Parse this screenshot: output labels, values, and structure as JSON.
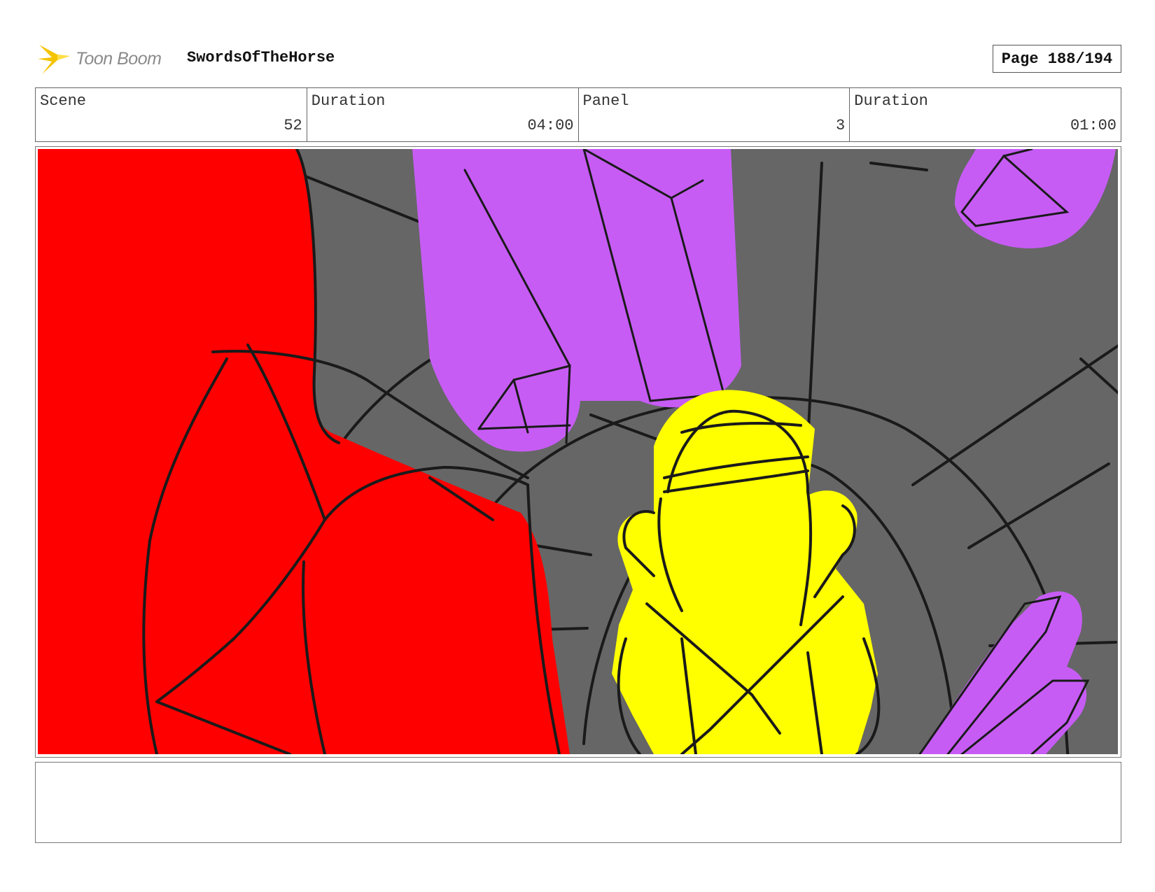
{
  "header": {
    "logo_text": "Toon Boom",
    "project_title": "SwordsOfTheHorse",
    "page_label": "Page 188/194"
  },
  "info": {
    "scene_label": "Scene",
    "scene_value": "52",
    "scene_duration_label": "Duration",
    "scene_duration_value": "04:00",
    "panel_label": "Panel",
    "panel_value": "3",
    "panel_duration_label": "Duration",
    "panel_duration_value": "01:00"
  },
  "colors": {
    "background_gray": "#666666",
    "red_figure": "#ff0000",
    "yellow_figure": "#ffff00",
    "crystals": "#c75cf5",
    "logo_star": "#f5c400"
  },
  "notes": {
    "text": ""
  }
}
